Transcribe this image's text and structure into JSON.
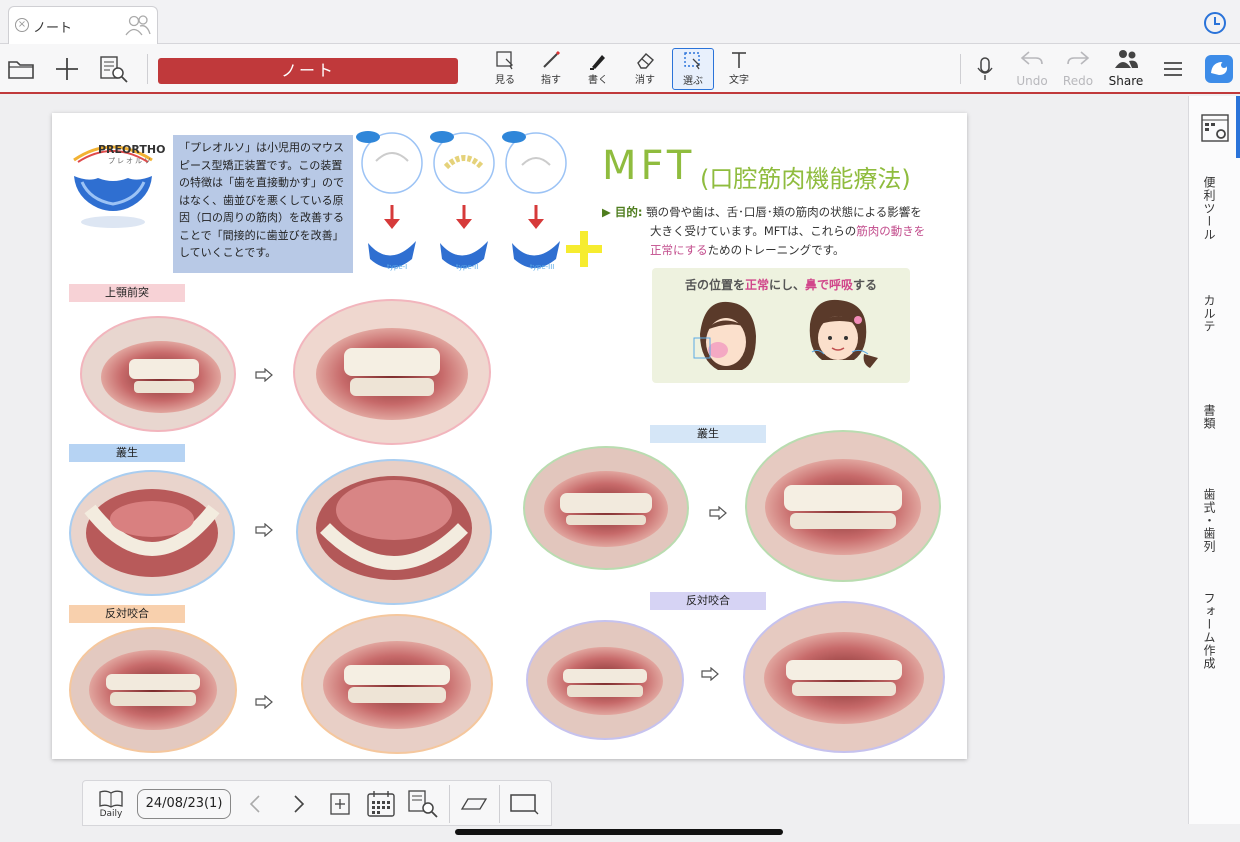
{
  "tab": {
    "title": "ノート"
  },
  "toolbar": {
    "note_title": "ノート",
    "tools": [
      "見る",
      "指す",
      "書く",
      "消す",
      "選ぶ",
      "文字"
    ],
    "undo": "Undo",
    "redo": "Redo",
    "share": "Share"
  },
  "side_tabs": [
    "便利ツール",
    "カルテ",
    "書類",
    "歯式・歯列",
    "フォーム作成"
  ],
  "page": {
    "logo": {
      "brand": "PREORTHO",
      "sub": "プレオルソ"
    },
    "description": "「プレオルソ」は小児用のマウスピース型矯正装置です。この装置の特徴は「歯を直接動かす」のではなく、歯並びを悪くしている原因（口の周りの筋肉）を改善することで「間接的に歯並びを改善」していくことです。",
    "mft_title": "MFT",
    "mft_subtitle": "(口腔筋肉機能療法)",
    "purpose_lead": "▶ 目的:",
    "purpose_line1": "顎の骨や歯は、舌･口唇･頬の筋肉の状態による影響を",
    "purpose_line2": "大きく受けています。MFTは、これらの",
    "purpose_hl": "筋肉の動きを",
    "purpose_line3": "正常にする",
    "purpose_line3b": "ためのトレーニングです。",
    "tongue_caption_a": "舌の位置を",
    "tongue_caption_b": "正常",
    "tongue_caption_c": "にし、",
    "tongue_caption_d": "鼻で呼吸",
    "tongue_caption_e": "する",
    "types": [
      "type-I",
      "type-II",
      "type-III"
    ],
    "labels": [
      "上顎前突",
      "叢生",
      "反対咬合",
      "叢生",
      "反対咬合"
    ]
  },
  "bottom": {
    "daily": "Daily",
    "date": "24/08/23(1)"
  }
}
